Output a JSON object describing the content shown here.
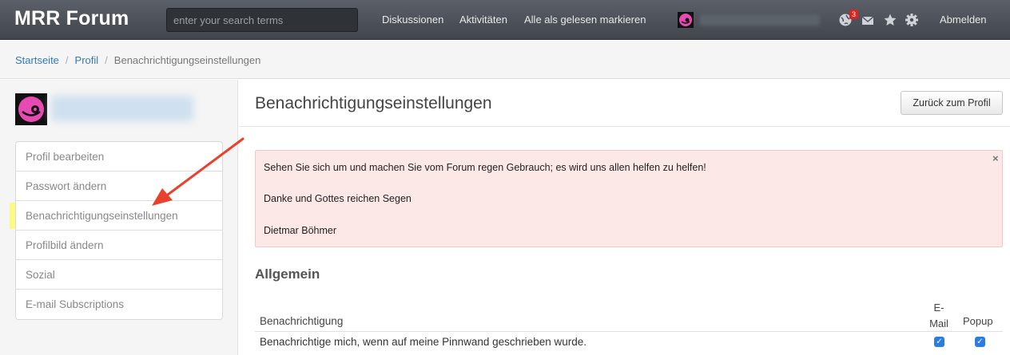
{
  "header": {
    "brand": "MRR Forum",
    "search_placeholder": "enter your search terms",
    "nav": [
      "Diskussionen",
      "Aktivitäten",
      "Alle als gelesen markieren"
    ],
    "notification_count": "3",
    "logout": "Abmelden",
    "icons": [
      "avatar",
      "globe-icon",
      "mail-icon",
      "star-icon",
      "gear-icon"
    ]
  },
  "breadcrumb": {
    "home": "Startseite",
    "profile": "Profil",
    "current": "Benachrichtigungseinstellungen"
  },
  "sidebar": {
    "menu": [
      "Profil bearbeiten",
      "Passwort ändern",
      "Benachrichtigungseinstellungen",
      "Profilbild ändern",
      "Sozial",
      "E-mail Subscriptions"
    ]
  },
  "main": {
    "title": "Benachrichtigungseinstellungen",
    "back_button": "Zurück zum Profil",
    "alert": {
      "line1": "Sehen Sie sich um und machen Sie vom Forum regen Gebrauch; es wird uns allen helfen zu helfen!",
      "line2": "Danke und Gottes reichen Segen",
      "line3": "Dietmar Böhmer",
      "close": "×"
    },
    "section": "Allgemein",
    "table": {
      "col_notification": "Benachrichtigung",
      "col_email_1": "E-",
      "col_email_2": "Mail",
      "col_popup": "Popup",
      "row1_label": "Benachrichtige mich, wenn auf meine Pinnwand geschrieben wurde.",
      "row1_email_checked": true,
      "row1_popup_checked": true
    }
  },
  "colors": {
    "navbar": "#4a4f56",
    "link": "#337ab7",
    "alert_bg": "#fde8e8",
    "highlight": "#fbfb7a",
    "arrow": "#e8412c",
    "checkbox": "#2b7de1"
  }
}
